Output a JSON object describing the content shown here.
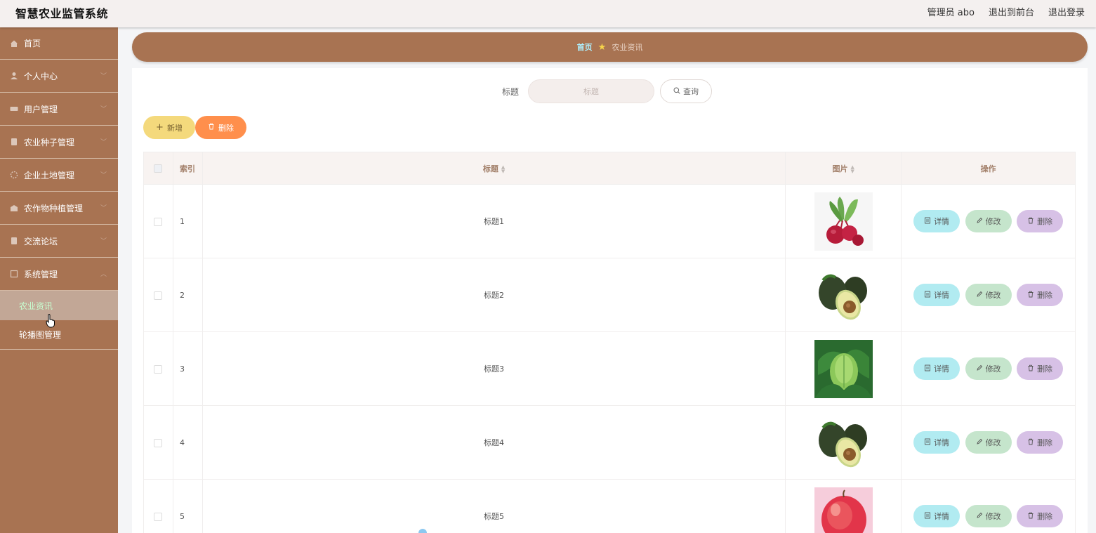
{
  "header": {
    "app_title": "智慧农业监管系统",
    "user_label": "管理员 abo",
    "front_link": "退出到前台",
    "logout_link": "退出登录"
  },
  "sidebar": {
    "items": [
      {
        "label": "首页",
        "icon": "home-icon"
      },
      {
        "label": "个人中心",
        "icon": "user-icon"
      },
      {
        "label": "用户管理",
        "icon": "users-icon"
      },
      {
        "label": "农业种子管理",
        "icon": "seed-icon"
      },
      {
        "label": "企业土地管理",
        "icon": "land-icon"
      },
      {
        "label": "农作物种植管理",
        "icon": "crop-icon"
      },
      {
        "label": "交流论坛",
        "icon": "forum-icon"
      },
      {
        "label": "系统管理",
        "icon": "system-icon"
      }
    ],
    "sub_items": [
      {
        "label": "农业资讯",
        "active": true
      },
      {
        "label": "轮播图管理",
        "active": false
      }
    ]
  },
  "breadcrumb": {
    "home": "首页",
    "current": "农业资讯"
  },
  "search": {
    "label": "标题",
    "placeholder": "标题",
    "button": "查询"
  },
  "actions": {
    "add": "新增",
    "delete": "删除"
  },
  "table": {
    "columns": [
      "索引",
      "标题",
      "图片",
      "操作"
    ],
    "rows": [
      {
        "index": "1",
        "title": "标题1",
        "image": "beetroot"
      },
      {
        "index": "2",
        "title": "标题2",
        "image": "avocado"
      },
      {
        "index": "3",
        "title": "标题3",
        "image": "cabbage"
      },
      {
        "index": "4",
        "title": "标题4",
        "image": "avocado"
      },
      {
        "index": "5",
        "title": "标题5",
        "image": "apple"
      }
    ],
    "op_labels": {
      "detail": "详情",
      "edit": "修改",
      "delete": "删除"
    }
  },
  "colors": {
    "sidebar_bg": "#a87352",
    "header_bg": "#f4f0ef",
    "add_button": "#f4d97c",
    "delete_button": "#ff8f4c",
    "detail_button": "#b1ebf1",
    "edit_button": "#c5e5cc",
    "row_delete_button": "#d7c1e6"
  }
}
